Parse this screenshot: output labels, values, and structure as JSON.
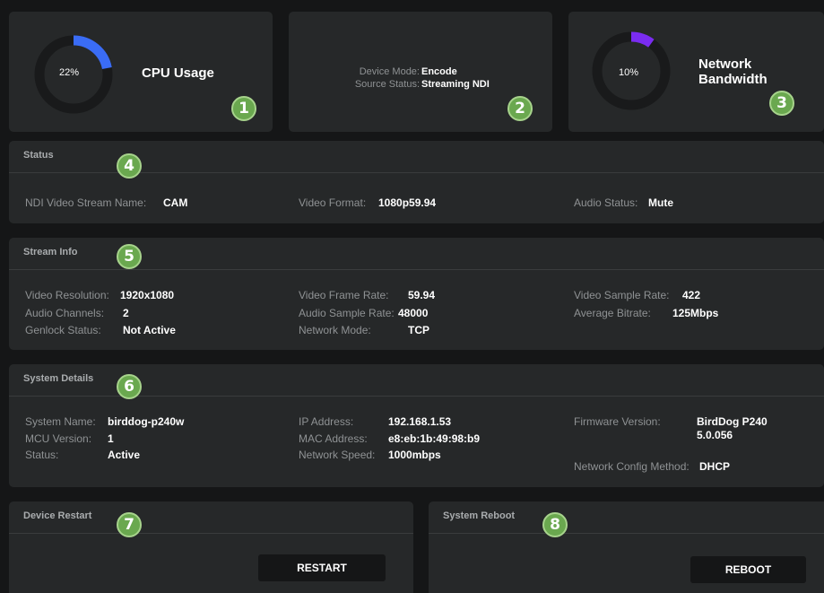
{
  "cpu": {
    "title": "CPU Usage",
    "percent_label": "22%",
    "percent": 22,
    "color": "#3a6cf5",
    "badge": "1"
  },
  "device": {
    "mode_label": "Device Mode:",
    "mode_value": "Encode",
    "source_label": "Source Status:",
    "source_value": "Streaming NDI",
    "badge": "2"
  },
  "network": {
    "title_line1": "Network",
    "title_line2": "Bandwidth",
    "percent_label": "10%",
    "percent": 10,
    "color": "#7a2cf0",
    "badge": "3"
  },
  "status": {
    "header": "Status",
    "badge": "4",
    "ndi_label": "NDI Video Stream Name:",
    "ndi_value": "CAM",
    "format_label": "Video Format:",
    "format_value": "1080p59.94",
    "audio_label": "Audio Status:",
    "audio_value": "Mute"
  },
  "stream": {
    "header": "Stream Info",
    "badge": "5",
    "res_label": "Video Resolution:",
    "res_value": "1920x1080",
    "ach_label": "Audio Channels:",
    "ach_value": "2",
    "genlock_label": "Genlock Status:",
    "genlock_value": "Not Active",
    "vfr_label": "Video Frame Rate:",
    "vfr_value": "59.94",
    "asr_label": "Audio Sample Rate:",
    "asr_value": "48000",
    "nmode_label": "Network Mode:",
    "nmode_value": "TCP",
    "vsr_label": "Video Sample Rate:",
    "vsr_value": "422",
    "abr_label": "Average Bitrate:",
    "abr_value": "125Mbps"
  },
  "system": {
    "header": "System Details",
    "badge": "6",
    "name_label": "System Name:",
    "name_value": "birddog-p240w",
    "mcu_label": "MCU Version:",
    "mcu_value": "1",
    "status_label": "Status:",
    "status_value": "Active",
    "ip_label": "IP Address:",
    "ip_value": "192.168.1.53",
    "mac_label": "MAC Address:",
    "mac_value": "e8:eb:1b:49:98:b9",
    "speed_label": "Network Speed:",
    "speed_value": "1000mbps",
    "fw_label": "Firmware Version:",
    "fw_value1": "BirdDog P240",
    "fw_value2": "5.0.056",
    "cfg_label": "Network Config Method:",
    "cfg_value": "DHCP"
  },
  "restart": {
    "header": "Device Restart",
    "badge": "7",
    "button": "RESTART"
  },
  "reboot": {
    "header": "System Reboot",
    "badge": "8",
    "button": "REBOOT"
  }
}
